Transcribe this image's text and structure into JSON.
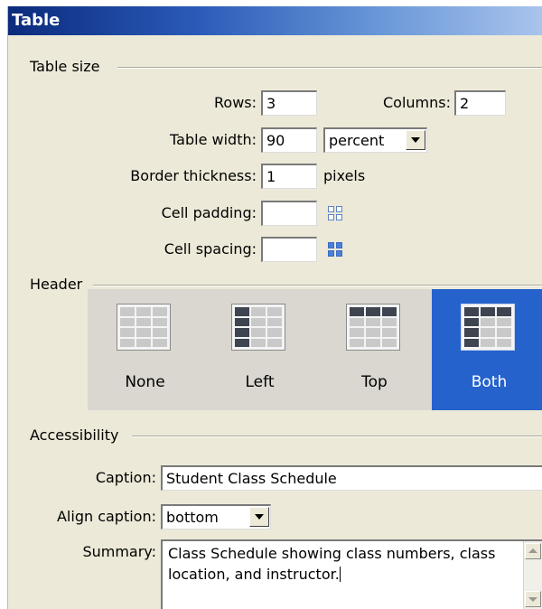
{
  "title": "Table",
  "table_size": {
    "section_label": "Table size",
    "rows_label": "Rows:",
    "rows_value": "3",
    "columns_label": "Columns:",
    "columns_value": "2",
    "table_width_label": "Table width:",
    "table_width_value": "90",
    "width_unit": "percent",
    "border_label": "Border thickness:",
    "border_value": "1",
    "border_unit": "pixels",
    "cell_padding_label": "Cell padding:",
    "cell_padding_value": "",
    "cell_spacing_label": "Cell spacing:",
    "cell_spacing_value": ""
  },
  "header": {
    "section_label": "Header",
    "options": [
      {
        "label": "None",
        "selected": false
      },
      {
        "label": "Left",
        "selected": false
      },
      {
        "label": "Top",
        "selected": false
      },
      {
        "label": "Both",
        "selected": true
      }
    ]
  },
  "accessibility": {
    "section_label": "Accessibility",
    "caption_label": "Caption:",
    "caption_value": "Student Class Schedule",
    "align_label": "Align caption:",
    "align_value": "bottom",
    "summary_label": "Summary:",
    "summary_value": "Class Schedule showing class numbers, class location, and instructor."
  },
  "colors": {
    "title_bar": "#0b2b7c",
    "dialog_bg": "#ece9d8",
    "selected_header": "#2562cc"
  },
  "icons": {
    "cell_padding": "grid-outline-icon",
    "cell_spacing": "grid-solid-icon",
    "header_none": "table-no-header-icon",
    "header_left": "table-left-header-icon",
    "header_top": "table-top-header-icon",
    "header_both": "table-both-header-icon"
  }
}
